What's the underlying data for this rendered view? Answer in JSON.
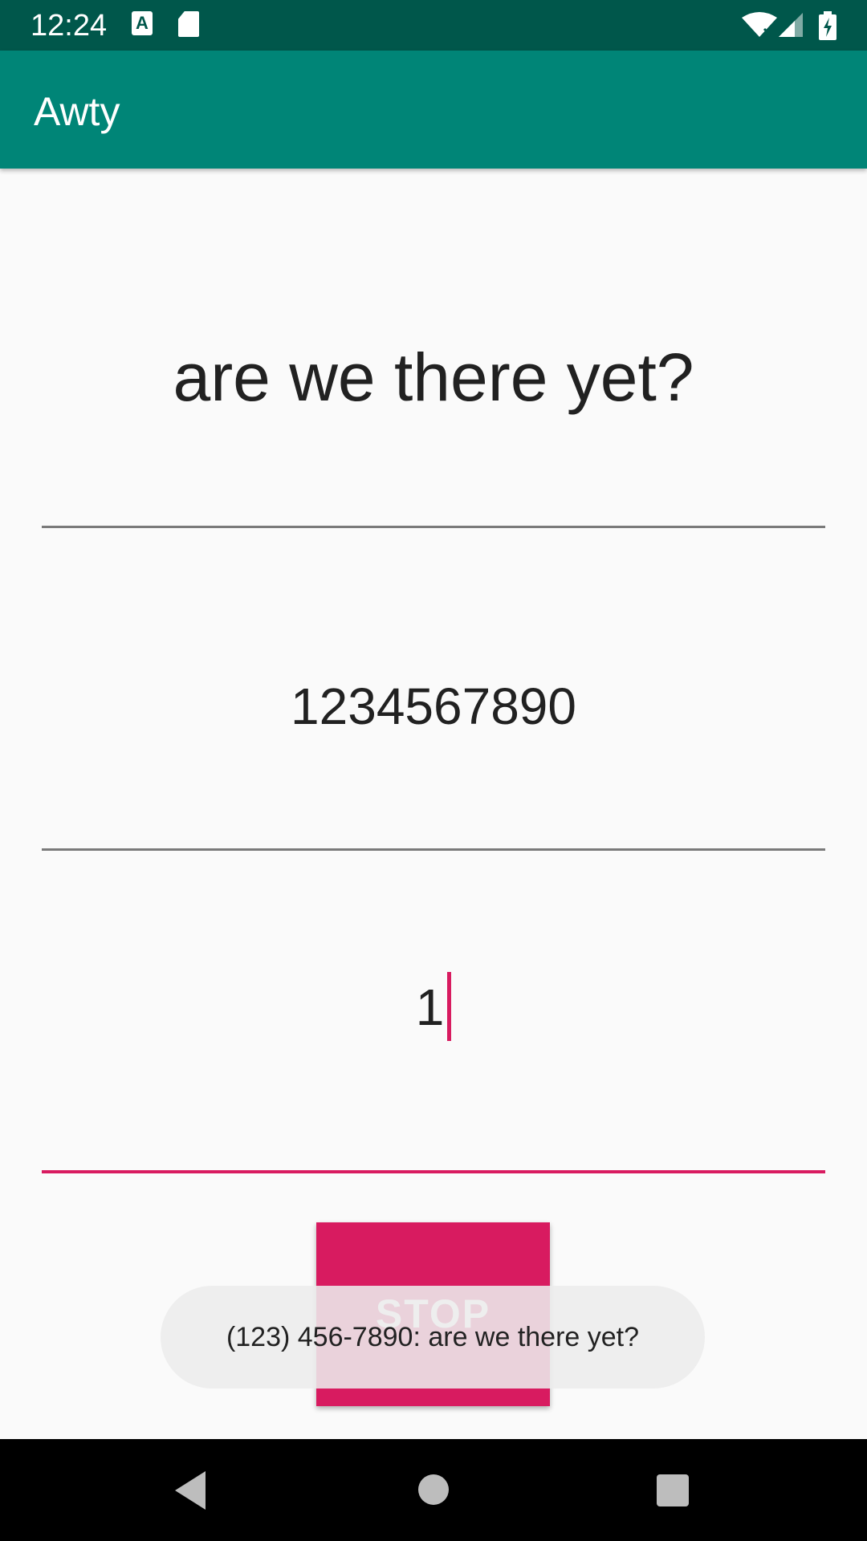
{
  "status_bar": {
    "time": "12:24",
    "icons": [
      "a-notification-icon",
      "sd-card-icon",
      "wifi-icon",
      "cell-signal-icon",
      "battery-charging-icon"
    ],
    "a_icon_text": "A"
  },
  "app_bar": {
    "title": "Awty"
  },
  "form": {
    "message": "are we there yet?",
    "phone": "1234567890",
    "minutes": "1"
  },
  "button": {
    "label": "STOP"
  },
  "toast": {
    "text": "(123) 456-7890: are we there yet?"
  },
  "colors": {
    "status_bar": "#00574b",
    "app_bar": "#008577",
    "accent": "#d81b60",
    "background": "#fafafa"
  }
}
